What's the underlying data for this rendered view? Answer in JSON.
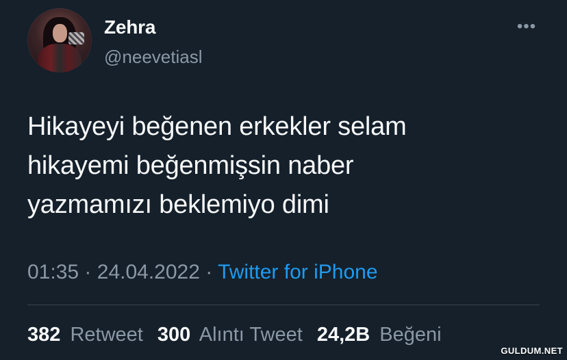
{
  "tweet": {
    "author": {
      "name": "Zehra",
      "handle": "@neevetiasl",
      "avatar_icon": "profile-photo"
    },
    "text_lines": [
      "Hikayeyi beğenen erkekler selam",
      "hikayemi beğenmişsin naber",
      "yazmamızı beklemiyo dimi"
    ],
    "time": "01:35",
    "separator": "·",
    "date": "24.04.2022",
    "source": "Twitter for iPhone",
    "stats": [
      {
        "count": "382",
        "label": "Retweet"
      },
      {
        "count": "300",
        "label": "Alıntı Tweet"
      },
      {
        "count": "24,2B",
        "label": "Beğeni"
      }
    ],
    "menu_icon": "more-horizontal-icon"
  },
  "colors": {
    "background": "#15202b",
    "primary_text": "#f7f9f9",
    "secondary_text": "#8b98a5",
    "accent": "#1d9bf0",
    "divider": "#38444d"
  },
  "watermark": "GULDUM.NET"
}
